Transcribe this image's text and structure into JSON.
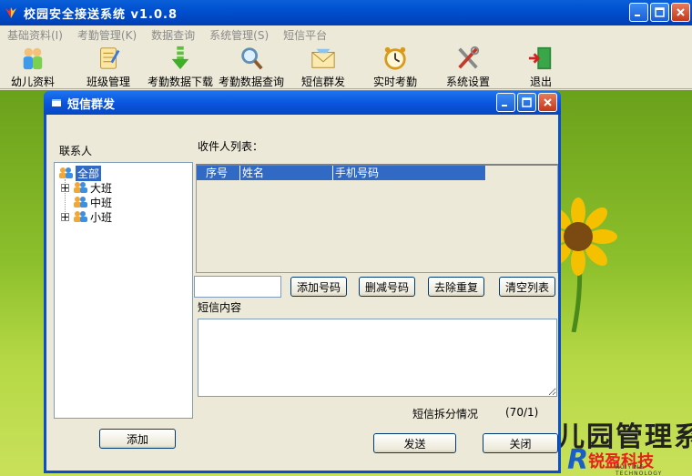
{
  "app": {
    "title": "校园安全接送系统 v1.0.8"
  },
  "menu": [
    "基础资料(I)",
    "考勤管理(K)",
    "数据查询",
    "系统管理(S)",
    "短信平台"
  ],
  "toolbar": [
    {
      "label": "幼儿资料",
      "icon": "children-icon"
    },
    {
      "label": "班级管理",
      "icon": "notebook-icon"
    },
    {
      "label": "考勤数据下载",
      "icon": "download-arrow-icon"
    },
    {
      "label": "考勤数据查询",
      "icon": "magnifier-icon"
    },
    {
      "label": "短信群发",
      "icon": "envelope-icon"
    },
    {
      "label": "实时考勤",
      "icon": "alarm-clock-icon"
    },
    {
      "label": "系统设置",
      "icon": "tools-icon"
    },
    {
      "label": "退出",
      "icon": "exit-door-icon"
    }
  ],
  "background": {
    "brand_main": "儿园管理系",
    "brand_logo": "锐盈科技",
    "brand_sub": "RUIYING TECHNOLOGY"
  },
  "dialog": {
    "title": "短信群发",
    "contacts_label": "联系人",
    "tree": {
      "root": "全部",
      "children": [
        "大班",
        "中班",
        "小班"
      ]
    },
    "recipients_label": "收件人列表：",
    "columns": [
      "序号",
      "姓名",
      "手机号码"
    ],
    "number_input": "",
    "buttons": {
      "add_number": "添加号码",
      "remove_number": "删减号码",
      "dedupe": "去除重复",
      "clear_list": "清空列表",
      "add": "添加",
      "send": "发送",
      "close": "关闭"
    },
    "content_label": "短信内容",
    "message": "",
    "split_label": "短信拆分情况",
    "split_value": "(70/1)"
  },
  "colors": {
    "titlebar": "#0a56df",
    "selection": "#316ac5",
    "window_bg": "#ece9d8"
  }
}
